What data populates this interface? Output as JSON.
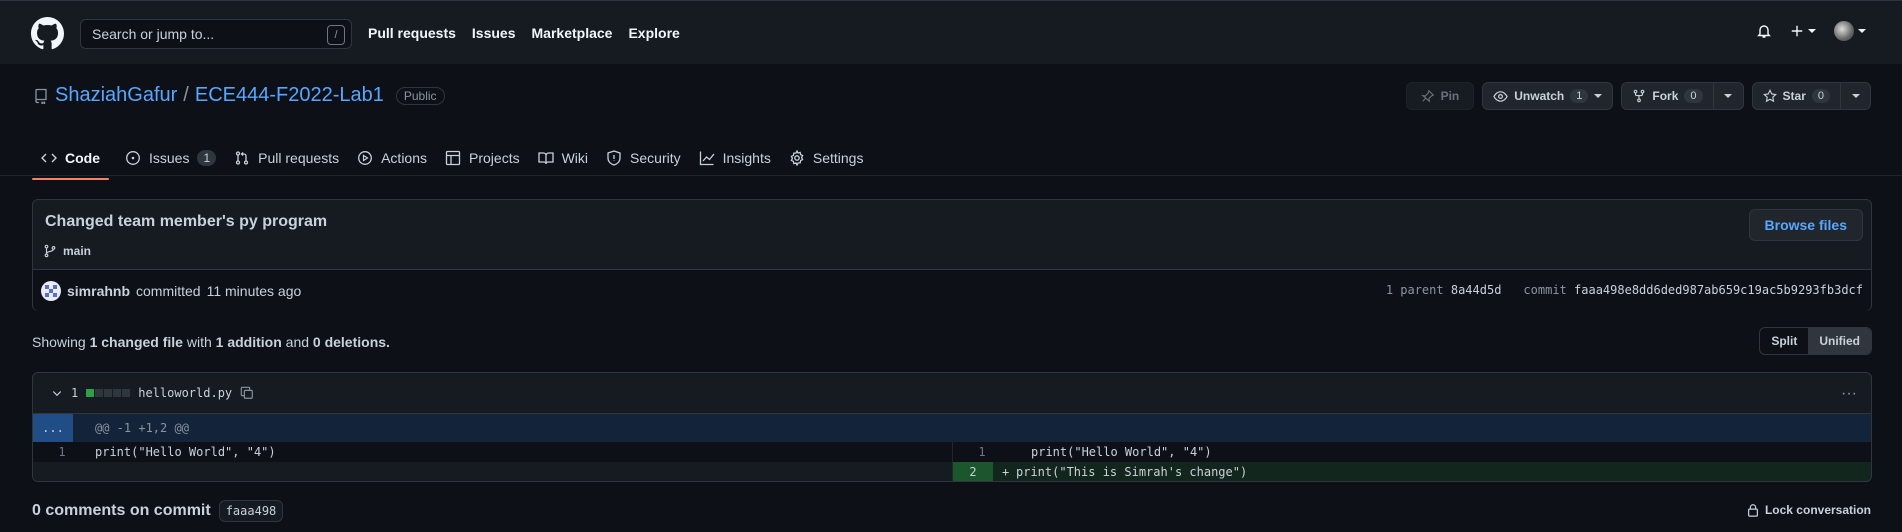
{
  "header": {
    "search_placeholder": "Search or jump to...",
    "search_shortcut": "/",
    "nav": [
      "Pull requests",
      "Issues",
      "Marketplace",
      "Explore"
    ]
  },
  "repo": {
    "owner": "ShaziahGafur",
    "separator": "/",
    "name": "ECE444-F2022-Lab1",
    "visibility": "Public",
    "pin_label": "Pin",
    "unwatch_label": "Unwatch",
    "unwatch_count": "1",
    "fork_label": "Fork",
    "fork_count": "0",
    "star_label": "Star",
    "star_count": "0"
  },
  "tabs": {
    "code": "Code",
    "issues": "Issues",
    "issues_count": "1",
    "pulls": "Pull requests",
    "actions": "Actions",
    "projects": "Projects",
    "wiki": "Wiki",
    "security": "Security",
    "insights": "Insights",
    "settings": "Settings"
  },
  "commit": {
    "title": "Changed team member's py program",
    "branch": "main",
    "browse_label": "Browse files",
    "author": "simrahnb",
    "action": "committed",
    "time": "11 minutes ago",
    "parent_label": "1 parent",
    "parent_sha": "8a44d5d",
    "commit_label": "commit",
    "commit_sha": "faaa498e8dd6ded987ab659c19ac5b9293fb3dcf"
  },
  "summary": {
    "showing": "Showing",
    "changed": "1 changed file",
    "with": "with",
    "additions": "1 addition",
    "and": "and",
    "deletions": "0 deletions.",
    "split": "Split",
    "unified": "Unified"
  },
  "diff": {
    "changes": "1",
    "filename": "helloworld.py",
    "expand": "...",
    "hunk": "@@ -1 +1,2 @@",
    "left": [
      {
        "num": "1",
        "code": "print(\"Hello World\", \"4\")"
      }
    ],
    "right": [
      {
        "num": "1",
        "marker": "",
        "code": "print(\"Hello World\", \"4\")"
      },
      {
        "num": "2",
        "marker": "+",
        "code": "print(\"This is Simrah's change\")"
      }
    ]
  },
  "comments": {
    "label": "0 comments on commit",
    "sha": "faaa498",
    "lock": "Lock conversation"
  },
  "colors": {
    "accent": "#58a6ff",
    "tab_underline": "#f78166",
    "addition": "#2ea043"
  }
}
